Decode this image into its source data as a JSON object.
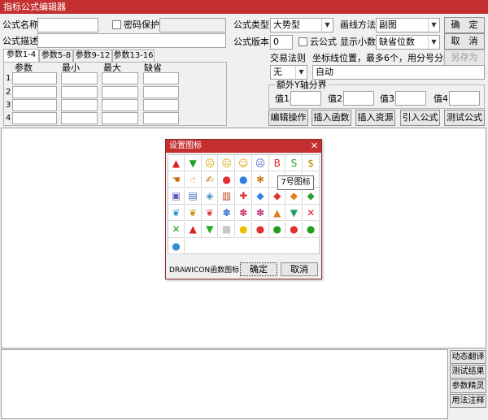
{
  "window": {
    "title": "指标公式编辑器"
  },
  "form": {
    "name_label": "公式名称",
    "name_value": "",
    "password_label": "密码保护",
    "desc_label": "公式描述",
    "desc_value": "",
    "type_label": "公式类型",
    "type_value": "大势型",
    "draw_label": "画线方法",
    "draw_value": "副图",
    "version_label": "公式版本",
    "version_value": "0",
    "cloud_label": "云公式",
    "decimals_label": "显示小数",
    "decimals_value": "缺省位数",
    "trade_label": "交易法则",
    "trade_value": "无",
    "coord_label": "坐标线位置，最多6个，用分号分隔",
    "coord_value": "自动",
    "yaxis_group": "额外Y轴分界",
    "yaxis_labels": [
      "值1",
      "值2",
      "值3",
      "值4"
    ]
  },
  "buttons": {
    "ok": "确　定",
    "cancel": "取　消",
    "saveas": "另存为",
    "edit_ops": "编辑操作",
    "insert_func": "插入函数",
    "insert_res": "插入资源",
    "import": "引入公式",
    "test": "测试公式"
  },
  "tabs": [
    "参数1-4",
    "参数5-8",
    "参数9-12",
    "参数13-16"
  ],
  "param_headers": [
    "参数",
    "最小",
    "最大",
    "缺省"
  ],
  "param_rows": [
    "1",
    "2",
    "3",
    "4"
  ],
  "side_buttons": [
    "动态翻译",
    "测试结果",
    "参数精灵",
    "用法注释"
  ],
  "dialog": {
    "title": "设置图标",
    "close": "✕",
    "tooltip": "7号图标",
    "footer_label": "DRAWICON函数图标",
    "ok": "确定",
    "cancel": "取消",
    "icons": [
      {
        "g": "▲",
        "c": "#e02020",
        "n": "up-arrow-icon"
      },
      {
        "g": "▼",
        "c": "#20a020",
        "n": "down-arrow-icon"
      },
      {
        "g": "☹",
        "c": "#e0a000",
        "n": "sad-face-icon"
      },
      {
        "g": "☹",
        "c": "#e0a000",
        "n": "frown-face-icon"
      },
      {
        "g": "☺",
        "c": "#e0a000",
        "n": "smile-face-icon"
      },
      {
        "g": "☹",
        "c": "#5060d0",
        "n": "angry-face-icon"
      },
      {
        "g": "B",
        "c": "#e02020",
        "n": "buy-letter-icon"
      },
      {
        "g": "S",
        "c": "#20a020",
        "n": "sell-letter-icon"
      },
      {
        "g": "$",
        "c": "#c08000",
        "n": "money-bag-icon"
      },
      {
        "g": "☚",
        "c": "#c07010",
        "n": "hand-left-icon"
      },
      {
        "g": "☝",
        "c": "#d09030",
        "n": "hand-up-icon"
      },
      {
        "g": "✍",
        "c": "#c07010",
        "n": "hand-write-icon"
      },
      {
        "g": "●",
        "c": "#e03030",
        "n": "red-ball-icon"
      },
      {
        "g": "●",
        "c": "#3080e0",
        "n": "blue-ball-icon"
      },
      {
        "g": "✱",
        "c": "#d08020",
        "n": "figure-icon"
      },
      {
        "g": "",
        "c": "#000",
        "n": "hidden-icon-a"
      },
      {
        "g": "",
        "c": "#000",
        "n": "hidden-icon-b"
      },
      {
        "g": "✿",
        "c": "#40a040",
        "n": "leaf-icon"
      },
      {
        "g": "▣",
        "c": "#6060c0",
        "n": "pot-icon"
      },
      {
        "g": "▤",
        "c": "#4070c0",
        "n": "phone-icon"
      },
      {
        "g": "◈",
        "c": "#4090c0",
        "n": "book-icon"
      },
      {
        "g": "▥",
        "c": "#c04020",
        "n": "books-icon"
      },
      {
        "g": "✚",
        "c": "#e03030",
        "n": "plus-circle-icon"
      },
      {
        "g": "◆",
        "c": "#3080e0",
        "n": "blue-gem-icon"
      },
      {
        "g": "◆",
        "c": "#e03030",
        "n": "red-gem-icon"
      },
      {
        "g": "◆",
        "c": "#e08020",
        "n": "orange-gem-icon"
      },
      {
        "g": "◆",
        "c": "#30a030",
        "n": "green-gem-icon"
      },
      {
        "g": "❦",
        "c": "#3090d0",
        "n": "blue-butterfly-icon"
      },
      {
        "g": "❦",
        "c": "#d09010",
        "n": "yellow-butterfly-icon"
      },
      {
        "g": "❦",
        "c": "#e04040",
        "n": "red-butterfly-icon"
      },
      {
        "g": "✽",
        "c": "#3070d0",
        "n": "blue-flower-icon"
      },
      {
        "g": "✽",
        "c": "#d03060",
        "n": "pink-flower-icon"
      },
      {
        "g": "✽",
        "c": "#c03080",
        "n": "magenta-flower-icon"
      },
      {
        "g": "▲",
        "c": "#e08020",
        "n": "orange-up-circle-icon"
      },
      {
        "g": "▼",
        "c": "#20a060",
        "n": "green-down-circle-icon"
      },
      {
        "g": "✕",
        "c": "#e02020",
        "n": "red-cross-icon"
      },
      {
        "g": "✕",
        "c": "#20a020",
        "n": "green-cross-icon"
      },
      {
        "g": "▲",
        "c": "#e02020",
        "n": "red-triangle-icon"
      },
      {
        "g": "▼",
        "c": "#20b020",
        "n": "green-triangle-icon"
      },
      {
        "g": "■",
        "c": "#c8c8c8",
        "n": "gray-square-icon"
      },
      {
        "g": "●",
        "c": "#f0c000",
        "n": "yellow-dot-icon"
      },
      {
        "g": "●",
        "c": "#e03030",
        "n": "red-badge-icon"
      },
      {
        "g": "●",
        "c": "#20a020",
        "n": "green-badge-icon"
      },
      {
        "g": "●",
        "c": "#e03030",
        "n": "red-buy-badge-icon"
      },
      {
        "g": "●",
        "c": "#20a020",
        "n": "green-sell-badge-icon"
      },
      {
        "g": "●",
        "c": "#3090d0",
        "n": "blue-badge-icon"
      }
    ]
  }
}
